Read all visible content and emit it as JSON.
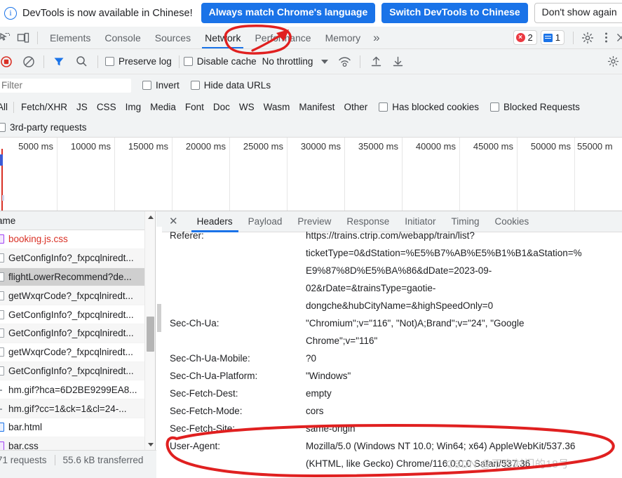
{
  "banner": {
    "icon": "info-icon",
    "text": "DevTools is now available in Chinese!",
    "btn_always": "Always match Chrome's language",
    "btn_switch": "Switch DevTools to Chinese",
    "btn_dont_show": "Don't show again"
  },
  "tabstrip": {
    "icons": [
      "inspect-element-icon",
      "device-toolbar-icon"
    ],
    "tabs": [
      {
        "label": "Elements",
        "active": false
      },
      {
        "label": "Console",
        "active": false
      },
      {
        "label": "Sources",
        "active": false
      },
      {
        "label": "Network",
        "active": true
      },
      {
        "label": "Performance",
        "active": false
      },
      {
        "label": "Memory",
        "active": false
      }
    ],
    "more": "»",
    "error_count": "2",
    "message_count": "1",
    "settings_icon": "gear-icon",
    "kebab_icon": "more-vertical-icon",
    "close_icon": "close-icon"
  },
  "network_toolbar": {
    "record_icon": "record-stop-icon",
    "clear_icon": "clear-icon",
    "filter_icon": "filter-funnel-icon",
    "search_icon": "search-icon",
    "preserve_log": "Preserve log",
    "disable_cache": "Disable cache",
    "throttling": "No throttling",
    "throttle_caret": "chevron-down-icon",
    "wifi_icon": "network-conditions-icon",
    "import_icon": "import-har-icon",
    "export_icon": "export-har-icon"
  },
  "filter_bar": {
    "placeholder": "Filter",
    "value": "",
    "invert": "Invert",
    "hide_data_urls": "Hide data URLs"
  },
  "type_filters": {
    "items": [
      "All",
      "Fetch/XHR",
      "JS",
      "CSS",
      "Img",
      "Media",
      "Font",
      "Doc",
      "WS",
      "Wasm",
      "Manifest",
      "Other"
    ],
    "has_blocked_cookies": "Has blocked cookies",
    "blocked_requests": "Blocked Requests",
    "third_party": "3rd-party requests"
  },
  "timeline": {
    "ticks": [
      "5000 ms",
      "10000 ms",
      "15000 ms",
      "20000 ms",
      "25000 ms",
      "30000 ms",
      "35000 ms",
      "40000 ms",
      "45000 ms",
      "50000 ms",
      "55000 m"
    ]
  },
  "requests": {
    "column_header": "ame",
    "rows": [
      {
        "name": "booking.js.css",
        "icon": "css-file-icon",
        "error": true,
        "selected": false
      },
      {
        "name": "GetConfigInfo?_fxpcqlniredt...",
        "icon": "xhr-file-icon",
        "error": false,
        "selected": false
      },
      {
        "name": "flightLowerRecommend?de...",
        "icon": "xhr-file-icon",
        "error": false,
        "selected": true
      },
      {
        "name": "getWxqrCode?_fxpcqlniredt...",
        "icon": "xhr-file-icon",
        "error": false,
        "selected": false
      },
      {
        "name": "GetConfigInfo?_fxpcqlniredt...",
        "icon": "xhr-file-icon",
        "error": false,
        "selected": false
      },
      {
        "name": "GetConfigInfo?_fxpcqlniredt...",
        "icon": "xhr-file-icon",
        "error": false,
        "selected": false
      },
      {
        "name": "getWxqrCode?_fxpcqlniredt...",
        "icon": "xhr-file-icon",
        "error": false,
        "selected": false
      },
      {
        "name": "GetConfigInfo?_fxpcqlniredt...",
        "icon": "xhr-file-icon",
        "error": false,
        "selected": false
      },
      {
        "name": "hm.gif?hca=6D2BE9299EA8...",
        "icon": "image-file-icon",
        "error": false,
        "selected": false
      },
      {
        "name": "hm.gif?cc=1&ck=1&cl=24-...",
        "icon": "image-file-icon",
        "error": false,
        "selected": false
      },
      {
        "name": "bar.html",
        "icon": "doc-file-icon",
        "error": false,
        "selected": false
      },
      {
        "name": "bar.css",
        "icon": "css-file-icon",
        "error": false,
        "selected": false
      }
    ]
  },
  "status_bar": {
    "requests": "71 requests",
    "transferred": "55.6 kB transferred"
  },
  "detail_panel": {
    "close_icon": "close-icon",
    "tabs": [
      {
        "label": "Headers",
        "active": true
      },
      {
        "label": "Payload",
        "active": false
      },
      {
        "label": "Preview",
        "active": false
      },
      {
        "label": "Response",
        "active": false
      },
      {
        "label": "Initiator",
        "active": false
      },
      {
        "label": "Timing",
        "active": false
      },
      {
        "label": "Cookies",
        "active": false
      }
    ],
    "headers": [
      {
        "key": "Referer:",
        "lines": [
          "https://trains.ctrip.com/webapp/train/list?",
          "ticketType=0&dStation=%E5%B7%AB%E5%B1%B1&aStation=%",
          "E9%87%8D%E5%BA%86&dDate=2023-09-",
          "02&rDate=&trainsType=gaotie-",
          "dongche&hubCityName=&highSpeedOnly=0"
        ]
      },
      {
        "key": "Sec-Ch-Ua:",
        "lines": [
          "\"Chromium\";v=\"116\", \"Not)A;Brand\";v=\"24\", \"Google",
          "Chrome\";v=\"116\""
        ]
      },
      {
        "key": "Sec-Ch-Ua-Mobile:",
        "lines": [
          "?0"
        ]
      },
      {
        "key": "Sec-Ch-Ua-Platform:",
        "lines": [
          "\"Windows\""
        ]
      },
      {
        "key": "Sec-Fetch-Dest:",
        "lines": [
          "empty"
        ]
      },
      {
        "key": "Sec-Fetch-Mode:",
        "lines": [
          "cors"
        ]
      },
      {
        "key": "Sec-Fetch-Site:",
        "lines": [
          "same-origin"
        ]
      },
      {
        "key": "User-Agent:",
        "lines": [
          "Mozilla/5.0 (Windows NT 10.0; Win64; x64) AppleWebKit/537.36",
          "(KHTML, like Gecko) Chrome/116.0.0.0 Safari/537.36"
        ]
      }
    ]
  },
  "annotations": {
    "color": "#e02020",
    "circle_network": "red-circle-network-tab",
    "arrow_network": "red-arrow-network-tab",
    "circle_useragent": "red-circle-user-agent"
  },
  "watermark": {
    "text": "CSDN @不会射门的18号"
  }
}
